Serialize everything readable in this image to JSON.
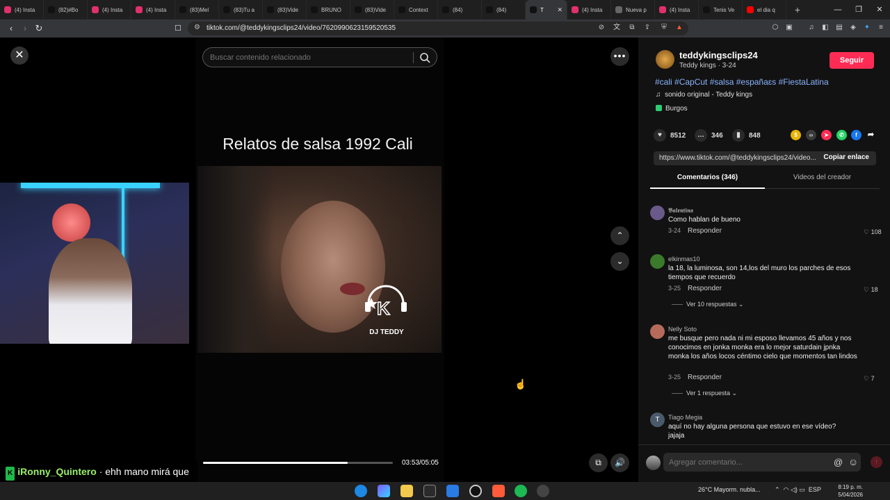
{
  "browser": {
    "tabs": [
      {
        "label": "(4) Insta",
        "color": "#e1306c"
      },
      {
        "label": "(82)#Bo",
        "color": "#111111"
      },
      {
        "label": "(4) Insta",
        "color": "#e1306c"
      },
      {
        "label": "(4) Insta",
        "color": "#e1306c"
      },
      {
        "label": "(83)Mel",
        "color": "#111111"
      },
      {
        "label": "(83)Tu a",
        "color": "#111111"
      },
      {
        "label": "(83)Vide",
        "color": "#111111"
      },
      {
        "label": "BRUNO",
        "color": "#111111"
      },
      {
        "label": "(83)Vide",
        "color": "#111111"
      },
      {
        "label": "Context",
        "color": "#111111"
      },
      {
        "label": "(84)",
        "color": "#111111"
      },
      {
        "label": "(84)",
        "color": "#111111"
      },
      {
        "label": "T",
        "color": "#111111",
        "active": true
      },
      {
        "label": "(4) Insta",
        "color": "#e1306c"
      },
      {
        "label": "Nueva p",
        "color": "#666666"
      },
      {
        "label": "(4) Insta",
        "color": "#e1306c"
      },
      {
        "label": "Tenis Ve",
        "color": "#111111"
      },
      {
        "label": "el dia q",
        "color": "#ff0000"
      }
    ],
    "url": "tiktok.com/@teddykingsclips24/video/7620990623159520535"
  },
  "player": {
    "search_placeholder": "Buscar contenido relacionado",
    "video_title": "Relatos de salsa 1992 Cali",
    "watermark": "DJ TEDDY",
    "time": "03:53/05:05",
    "progress": 0.762
  },
  "chat": {
    "user": "iRonny_Quintero",
    "message": "· ehh mano mirá que mi me interesa mucho sobre la cali vieja"
  },
  "creator": {
    "name": "teddykingsclips24",
    "sub": "Teddy kings · 3-24",
    "follow": "Seguir",
    "hashtags": "#cali #CapCut #salsa #españaɛs #FiestaLatina",
    "sound": "sonido original - Teddy kings",
    "location": "Burgos"
  },
  "stats": {
    "likes": "8512",
    "comments": "346",
    "saves": "848"
  },
  "link": {
    "url": "https://www.tiktok.com/@teddykingsclips24/video...",
    "copy": "Copiar enlace"
  },
  "tabs_panel": {
    "comments": "Comentarios (346)",
    "videos": "Videos del creador"
  },
  "comments": [
    {
      "user": "𝕭𝖆𝖑𝖊𝖓𝖙𝖎𝖓𝖆",
      "text": "Como hablan de bueno",
      "date": "3-24",
      "reply": "Responder",
      "likes": "108",
      "avatar": "#6a5a8a"
    },
    {
      "user": "elkinmas10",
      "text": "la 18, la luminosa, son 14,los del muro los parches de esos tiempos que recuerdo",
      "date": "3-25",
      "reply": "Responder",
      "likes": "18",
      "more": "Ver 10 respuestas ⌄",
      "avatar": "#3b7a2a"
    },
    {
      "user": "Nelly Soto",
      "text": "me busque pero nada ni mi esposo llevamos 45 años y nos conocimos en jonka monka era lo mejor saturdain jpnka monka los años locos céntimo cielo que momentos tan lindos",
      "date": "3-25",
      "reply": "Responder",
      "likes": "7",
      "more": "Ver 1 respuesta ⌄",
      "avatar": "#b56a5a"
    },
    {
      "user": "Tiago Megia",
      "text": "aquí no hay alguna persona que estuvo en ese vídeo? jajaja",
      "avatar": "#4a5a6a",
      "initial": "T"
    }
  ],
  "comment_bar": {
    "placeholder": "Agregar comentario..."
  },
  "taskbar": {
    "weather": "26°C  Mayorm. nubla...",
    "lang": "ESP",
    "time": "8:19 p. m.",
    "date": "5/04/2026"
  }
}
